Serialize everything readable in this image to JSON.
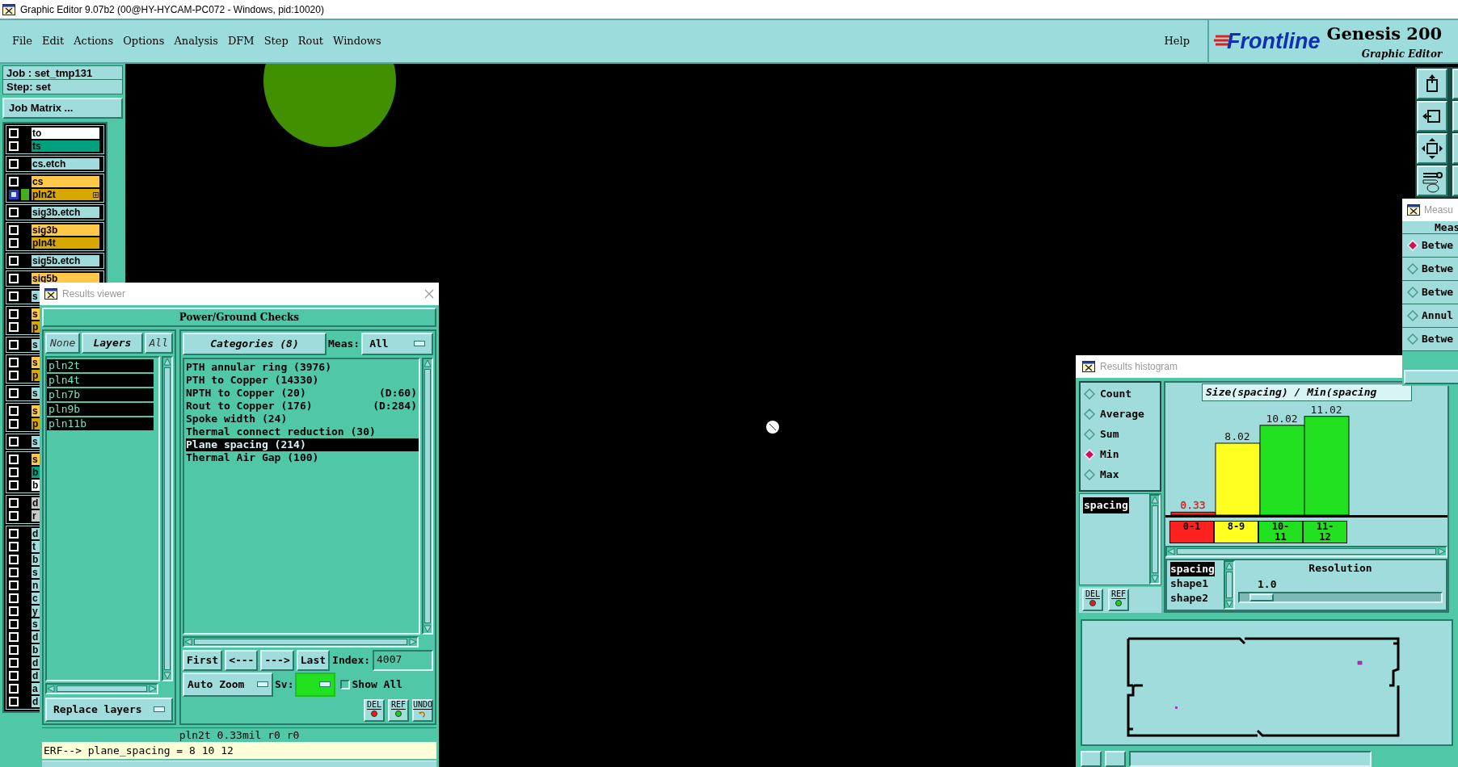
{
  "window": {
    "title": "Graphic Editor 9.07b2 (00@HY-HYCAM-PC072 - Windows, pid:10020)"
  },
  "menu": [
    "File",
    "Edit",
    "Actions",
    "Options",
    "Analysis",
    "DFM",
    "Step",
    "Rout",
    "Windows"
  ],
  "help": "Help",
  "logo": {
    "brand": "Frontline",
    "product": "Genesis 200",
    "subtitle": "Graphic Editor"
  },
  "job": {
    "job": "Job : set_tmp131",
    "step": "Step: set",
    "matrix_button": "Job Matrix ..."
  },
  "layer_groups": [
    [
      {
        "name": "to",
        "color": "#ffffff",
        "active": false
      },
      {
        "name": "ts",
        "color": "#00a080",
        "active": false
      }
    ],
    [
      {
        "name": "cs.etch",
        "color": "#a0dcdc",
        "active": false
      }
    ],
    [
      {
        "name": "cs",
        "color": "#ffc848",
        "active": false
      },
      {
        "name": "pln2t",
        "color": "#d8a800",
        "active": true
      }
    ],
    [
      {
        "name": "sig3b.etch",
        "color": "#a0dcdc",
        "active": false
      }
    ],
    [
      {
        "name": "sig3b",
        "color": "#ffc848",
        "active": false
      },
      {
        "name": "pln4t",
        "color": "#d8a800",
        "active": false
      }
    ],
    [
      {
        "name": "sig5b.etch",
        "color": "#a0dcdc",
        "active": false
      }
    ],
    [
      {
        "name": "sig5b",
        "color": "#ffc848",
        "active": false
      }
    ],
    [
      {
        "name": "s",
        "color": "#a0dcdc",
        "active": false
      }
    ],
    [
      {
        "name": "s",
        "color": "#ffc848",
        "active": false
      },
      {
        "name": "p",
        "color": "#d8a800",
        "active": false
      }
    ],
    [
      {
        "name": "s",
        "color": "#a0dcdc",
        "active": false
      }
    ],
    [
      {
        "name": "s",
        "color": "#ffc848",
        "active": false
      },
      {
        "name": "p",
        "color": "#d8a800",
        "active": false
      }
    ],
    [
      {
        "name": "s",
        "color": "#a0dcdc",
        "active": false
      }
    ],
    [
      {
        "name": "s",
        "color": "#ffc848",
        "active": false
      },
      {
        "name": "p",
        "color": "#d8a800",
        "active": false
      }
    ],
    [
      {
        "name": "s",
        "color": "#a0dcdc",
        "active": false
      }
    ],
    [
      {
        "name": "s",
        "color": "#ffc848",
        "active": false
      },
      {
        "name": "b",
        "color": "#00a080",
        "active": false
      },
      {
        "name": "b",
        "color": "#ffffff",
        "active": false
      }
    ],
    [
      {
        "name": "d",
        "color": "#c8c8c8",
        "active": false
      },
      {
        "name": "r",
        "color": "#c8c8c8",
        "active": false
      }
    ],
    [
      {
        "name": "d",
        "color": "#a0dcdc",
        "active": false
      },
      {
        "name": "t",
        "color": "#a0dcdc",
        "active": false
      },
      {
        "name": "b",
        "color": "#a0dcdc",
        "active": false
      },
      {
        "name": "s",
        "color": "#a0dcdc",
        "active": false
      },
      {
        "name": "n",
        "color": "#a0dcdc",
        "active": false
      },
      {
        "name": "c",
        "color": "#a0dcdc",
        "active": false
      },
      {
        "name": "y",
        "color": "#a0dcdc",
        "active": false
      },
      {
        "name": "s",
        "color": "#a0dcdc",
        "active": false
      },
      {
        "name": "d",
        "color": "#a0dcdc",
        "active": false
      },
      {
        "name": "b",
        "color": "#a0dcdc",
        "active": false
      },
      {
        "name": "d",
        "color": "#a0dcdc",
        "active": false
      },
      {
        "name": "d",
        "color": "#a0dcdc",
        "active": false
      },
      {
        "name": "a",
        "color": "#a0dcdc",
        "active": false
      },
      {
        "name": "d",
        "color": "#a0dcdc",
        "active": false
      }
    ]
  ],
  "results_viewer": {
    "title": "Results viewer",
    "header": "Power/Ground Checks",
    "layer_tabs": [
      {
        "label": "None",
        "selected": false
      },
      {
        "label": "Layers",
        "selected": true
      },
      {
        "label": "All",
        "selected": false
      }
    ],
    "layers": [
      "pln2t",
      "pln4t",
      "pln7b",
      "pln9b",
      "pln11b"
    ],
    "categories_button": "Categories (8)",
    "meas_label": "Meas:",
    "meas_value": "All",
    "categories": [
      {
        "label": "PTH annular ring (3976)",
        "selected": false
      },
      {
        "label": "PTH to Copper (14330)",
        "selected": false
      },
      {
        "label": "NPTH to Copper (20)",
        "note": "(D:60)",
        "selected": false
      },
      {
        "label": "Rout to Copper (176)",
        "note": "(D:284)",
        "selected": false
      },
      {
        "label": "Spoke width (24)",
        "selected": false
      },
      {
        "label": "Thermal connect reduction (30)",
        "selected": false
      },
      {
        "label": "Plane spacing (214)",
        "selected": true
      },
      {
        "label": "Thermal Air Gap (100)",
        "selected": false
      }
    ],
    "nav": [
      "First",
      "<---",
      "--->",
      "Last"
    ],
    "index_label": "Index:",
    "index_value": "4007",
    "zoom_option": "Auto Zoom",
    "sv_label": "Sv:",
    "show_all": {
      "label": "Show All",
      "checked": false
    },
    "icon_buttons": [
      "DEL",
      "REF",
      "UNDO"
    ],
    "replace_option": "Replace layers",
    "status": "pln2t 0.33mil  r0  r0",
    "erf": "ERF--> plane_spacing = 8 10 12"
  },
  "histogram": {
    "title": "Results histogram",
    "modes": [
      {
        "label": "Count",
        "selected": false
      },
      {
        "label": "Average",
        "selected": false
      },
      {
        "label": "Sum",
        "selected": false
      },
      {
        "label": "Min",
        "selected": true
      },
      {
        "label": "Max",
        "selected": false
      }
    ],
    "attributes": [
      {
        "label": "spacing",
        "selected": true
      }
    ],
    "buttons": [
      "DEL",
      "REF"
    ],
    "chart_data": {
      "type": "bar",
      "title": "Size(spacing) / Min(spacing",
      "categories": [
        "0-1",
        "8-9",
        "10-11",
        "11-12"
      ],
      "series": [
        {
          "values": [
            0.33,
            8.02,
            10.02,
            11.02
          ]
        }
      ],
      "data_labels": true
    },
    "bins": [
      {
        "color": "#ff2020"
      },
      {
        "color": "#ffff20"
      },
      {
        "color": "#20e020"
      },
      {
        "color": "#20e020"
      }
    ],
    "shapes": [
      {
        "label": "spacing",
        "selected": true
      },
      {
        "label": "shape1",
        "selected": false
      },
      {
        "label": "shape2",
        "selected": false
      }
    ],
    "resolution": {
      "label": "Resolution",
      "value": "1.0",
      "level": 0.05
    }
  },
  "measure": {
    "title": "Measu",
    "header": "Meas",
    "options": [
      {
        "label": "Betwe",
        "selected": true
      },
      {
        "label": "Betwe",
        "selected": false
      },
      {
        "label": "Betwe",
        "selected": false
      },
      {
        "label": "Annul",
        "selected": false
      },
      {
        "label": "Betwe",
        "selected": false
      }
    ]
  }
}
